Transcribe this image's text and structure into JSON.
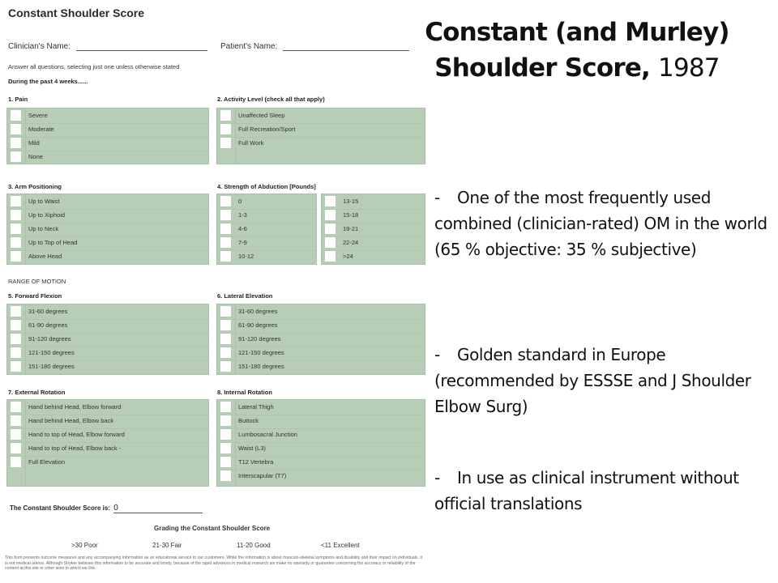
{
  "form": {
    "title": "Constant Shoulder Score",
    "clinician_label": "Clinician's Name:",
    "patient_label": "Patient's Name:",
    "instructions": "Answer all questions, selecting just one unless otherwise stated",
    "during": "During the past 4 weeks......",
    "range_of_motion": "RANGE OF MOTION",
    "questions": {
      "pain": {
        "label": "1. Pain",
        "options": [
          "Severe",
          "Moderate",
          "Mild",
          "None"
        ]
      },
      "activity": {
        "label": "2. Activity Level (check all that apply)",
        "options": [
          "Unaffected Sleep",
          "Full Recreation/Sport",
          "Full Work"
        ]
      },
      "arm": {
        "label": "3. Arm Positioning",
        "options": [
          "Up to Waist",
          "Up to Xiphoid",
          "Up to Neck",
          "Up to Top of Head",
          "Above Head"
        ]
      },
      "strength": {
        "label": "4. Strength of Abduction [Pounds]",
        "options_left": [
          "0",
          "1-3",
          "4-6",
          "7-9",
          "10-12"
        ],
        "options_right": [
          "13-15",
          "15-18",
          "19-21",
          "22-24",
          ">24"
        ]
      },
      "flexion": {
        "label": "5. Forward Flexion",
        "options": [
          "31-60 degrees",
          "61-90 degrees",
          "91-120 degrees",
          "121-150 degrees",
          "151-180 degrees"
        ]
      },
      "elevation": {
        "label": "6. Lateral Elevation",
        "options": [
          "31-60 degrees",
          "61-90 degrees",
          "91-120 degrees",
          "121-150 degrees",
          "151-180 degrees"
        ]
      },
      "external": {
        "label": "7. External Rotation",
        "options": [
          "Hand behind Head, Elbow forward",
          "Hand behind Head, Elbow back",
          "Hand to top of Head, Elbow forward",
          "Hand to top of Head, Elbow back -",
          "Full Elevation"
        ]
      },
      "internal": {
        "label": "8. Internal Rotation",
        "options": [
          "Lateral Thigh",
          "Buttock",
          "Lumbosacral Junction",
          "Waist (L3)",
          "T12 Vertebra",
          "Interscapular (T7)"
        ]
      }
    },
    "score_label": "The Constant Shoulder Score is:",
    "score_value": "0",
    "grading_title": "Grading the Constant Shoulder Score",
    "grades": [
      ">30 Poor",
      "21-30 Fair",
      "11-20 Good",
      "<11 Excellent"
    ],
    "disclaimer": "This form presents outcome measures and any accompanying information as an educational service to our customers. While the information is about musculo-skeletal symptoms and disability and their impact on individuals, it is not medical advice. Although Stryker believes this information to be accurate and timely, because of the rapid advances in medical research we make no warranty or guarantee concerning the accuracy or reliability of the content at this site or other sites to which we link."
  },
  "slide": {
    "title_line1": "Constant (and Murley)",
    "title_line2": "Shoulder Score,",
    "title_year": "1987",
    "bullets": [
      "One of the most frequently used combined (clinician-rated) OM in the world (65 % objective: 35 % subjective)",
      "Golden standard in Europe (recommended by ESSSE and J Shoulder Elbow Surg)",
      "In use as clinical instrument without official translations"
    ],
    "bullet_marker": "-"
  },
  "colors": {
    "option_box": "#b7cdb6",
    "checkbox": "#ffffff"
  }
}
